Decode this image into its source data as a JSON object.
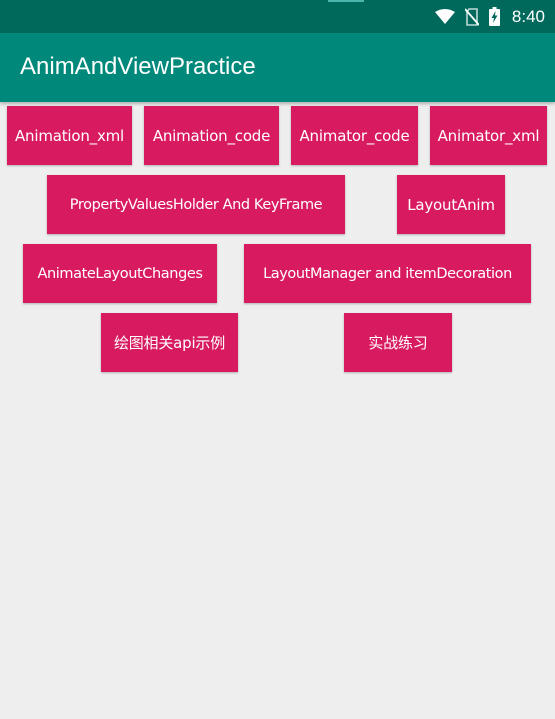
{
  "status_bar": {
    "time": "8:40",
    "icons": [
      "wifi-icon",
      "no-sim-icon",
      "battery-charging-icon"
    ]
  },
  "app_bar": {
    "title": "AnimAndViewPractice"
  },
  "buttons": {
    "animation_xml": "Animation_xml",
    "animation_code": "Animation_code",
    "animator_code": "Animator_code",
    "animator_xml": "Animator_xml",
    "property_values_holder": "PropertyValuesHolder And KeyFrame",
    "layout_anim": "LayoutAnim",
    "animate_layout_changes": "AnimateLayoutChanges",
    "layout_manager": "LayoutManager and itemDecoration",
    "drawing_api": "绘图相关api示例",
    "practice": "实战练习"
  },
  "colors": {
    "status_bar": "#00695c",
    "app_bar": "#00897b",
    "button": "#d81b60",
    "background": "#eeeeee"
  }
}
